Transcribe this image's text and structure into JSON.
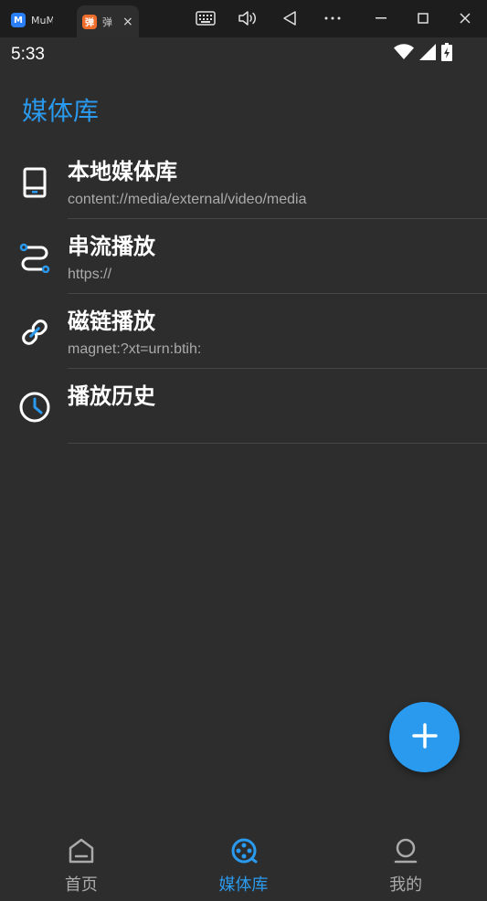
{
  "window": {
    "tabs": [
      {
        "label": "MuMu",
        "favicon": "mumu-logo"
      },
      {
        "label": "弹",
        "favicon": "app-logo"
      }
    ],
    "tab_close": "×",
    "toolbar_icons": [
      "keyboard-icon",
      "volume-icon",
      "back-triangle-icon",
      "more-icon",
      "minimize-icon",
      "maximize-icon",
      "close-icon"
    ]
  },
  "status_bar": {
    "time": "5:33",
    "icons": [
      "wifi-icon",
      "signal-icon",
      "battery-charging-icon"
    ]
  },
  "header": {
    "title": "媒体库"
  },
  "list": [
    {
      "title": "本地媒体库",
      "subtitle": "content://media/external/video/media",
      "icon": "tablet-icon"
    },
    {
      "title": "串流播放",
      "subtitle": "https://",
      "icon": "route-icon"
    },
    {
      "title": "磁链播放",
      "subtitle": "magnet:?xt=urn:btih:",
      "icon": "link-icon"
    },
    {
      "title": "播放历史",
      "subtitle": "",
      "icon": "clock-icon"
    }
  ],
  "fab": {
    "icon": "plus-icon"
  },
  "bottom_nav": [
    {
      "label": "首页",
      "icon": "home-icon",
      "active": false
    },
    {
      "label": "媒体库",
      "icon": "film-reel-icon",
      "active": true
    },
    {
      "label": "我的",
      "icon": "person-icon",
      "active": false
    }
  ],
  "colors": {
    "accent": "#2a9aef",
    "background": "#2d2d2d",
    "chrome": "#1d1d1d",
    "subtitle": "#aaaaaa"
  }
}
